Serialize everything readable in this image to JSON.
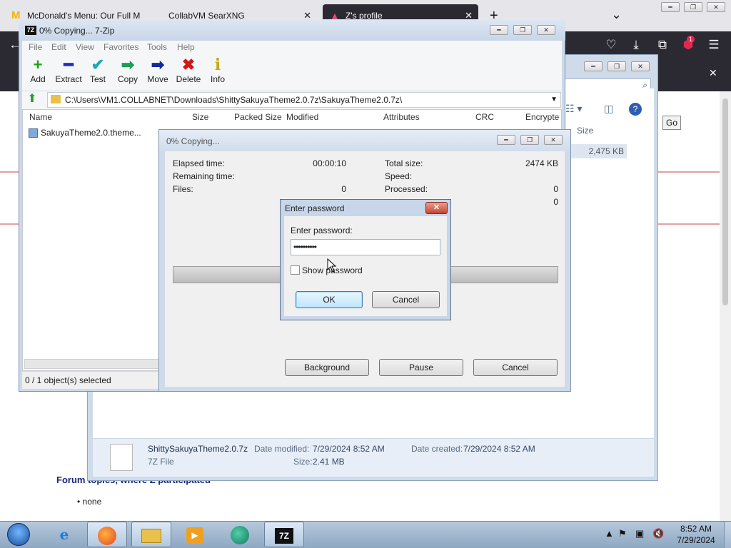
{
  "firefox": {
    "tabs": [
      {
        "title": "McDonald's Menu: Our Full Mc"
      },
      {
        "title": "CollabVM SearXNG"
      },
      {
        "title": "Z's profile"
      }
    ],
    "new_tab": "+",
    "tab_list": "⌄",
    "back_icon": "back-arrow-icon",
    "badge": "1",
    "go_label": "Go"
  },
  "webpage": {
    "forum_heading": "Forum topics, where Z participated",
    "bullet": "none"
  },
  "explorer": {
    "size_header": "Size",
    "file_size": "2,475 KB",
    "details": {
      "name": "ShittySakuyaTheme2.0.7z",
      "type": "7Z File",
      "modified_label": "Date modified:",
      "modified_value": "7/29/2024 8:52 AM",
      "created_label": "Date created:",
      "created_value": "7/29/2024 8:52 AM",
      "size_label": "Size:",
      "size_value": "2.41 MB"
    }
  },
  "sevenzip": {
    "title": "0% Copying... 7-Zip",
    "logo": "7Z",
    "menu": [
      "File",
      "Edit",
      "View",
      "Favorites",
      "Tools",
      "Help"
    ],
    "toolbar": [
      {
        "label": "Add",
        "icon": "+",
        "color": "#17a317"
      },
      {
        "label": "Extract",
        "icon": "━",
        "color": "#1c2fb4"
      },
      {
        "label": "Test",
        "icon": "✔",
        "color": "#18a8b8"
      },
      {
        "label": "Copy",
        "icon": "➡",
        "color": "#18a058"
      },
      {
        "label": "Move",
        "icon": "➡",
        "color": "#122a9a"
      },
      {
        "label": "Delete",
        "icon": "✖",
        "color": "#d01818"
      },
      {
        "label": "Info",
        "icon": "i",
        "color": "#c8a800"
      }
    ],
    "address": "C:\\Users\\VM1.COLLABNET\\Downloads\\ShittySakuyaTheme2.0.7z\\SakuyaTheme2.0.7z\\",
    "columns": [
      "Name",
      "Size",
      "Packed Size",
      "Modified",
      "Attributes",
      "CRC",
      "Encrypte"
    ],
    "files": [
      {
        "name": "SakuyaTheme2.0.theme..."
      }
    ],
    "status": "0 / 1 object(s) selected"
  },
  "progress": {
    "title": "0% Copying...",
    "elapsed_label": "Elapsed time:",
    "elapsed_value": "00:00:10",
    "remaining_label": "Remaining time:",
    "files_label": "Files:",
    "files_value": "0",
    "total_label": "Total size:",
    "total_value": "2474 KB",
    "speed_label": "Speed:",
    "processed_label": "Processed:",
    "processed_value": "0",
    "extra_value": "0",
    "percent": 0,
    "buttons": {
      "background": "Background",
      "pause": "Pause",
      "cancel": "Cancel"
    }
  },
  "password_dialog": {
    "title": "Enter password",
    "prompt": "Enter password:",
    "value": "••••••••••",
    "show_password": "Show password",
    "show_password_checked": false,
    "ok": "OK",
    "cancel": "Cancel"
  },
  "taskbar": {
    "clock_time": "8:52 AM",
    "clock_date": "7/29/2024",
    "pinned": [
      "start-orb",
      "internet-explorer",
      "firefox",
      "file-explorer",
      "media-player",
      "chrome-like",
      "7-zip"
    ]
  }
}
